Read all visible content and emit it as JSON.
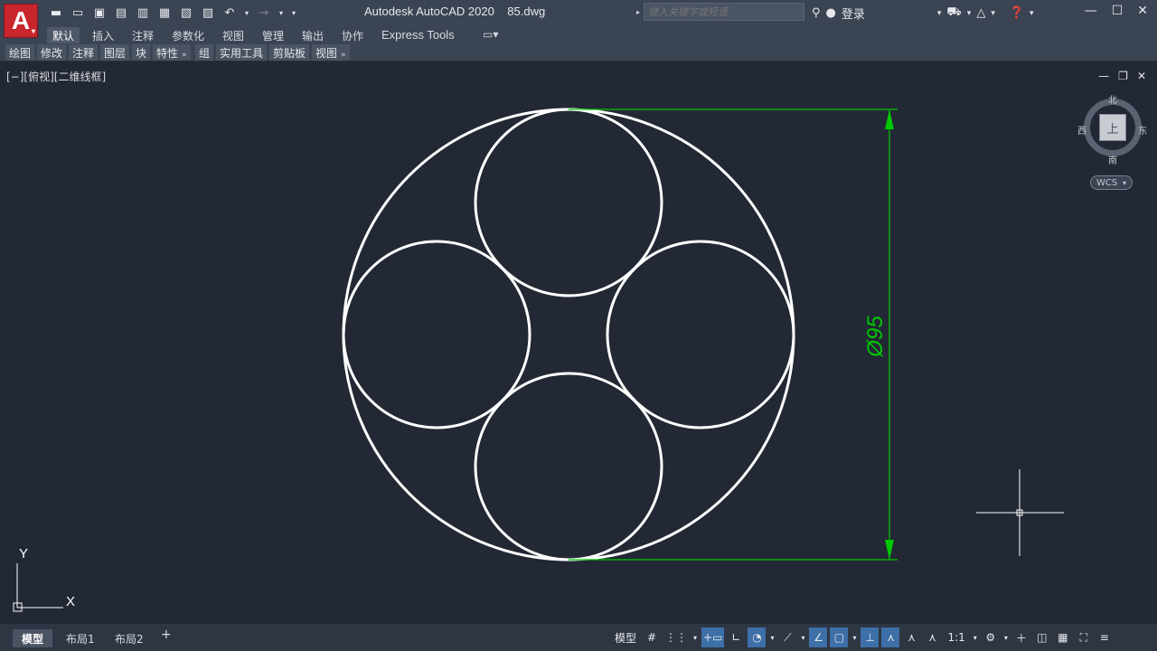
{
  "window": {
    "title": "Autodesk AutoCAD 2020    85.dwg",
    "app_letter": "A",
    "search_placeholder": "键入关键字或短语",
    "sign_in": "登录"
  },
  "ribbon": {
    "tabs": [
      {
        "label": "默认",
        "active": true
      },
      {
        "label": "插入"
      },
      {
        "label": "注释"
      },
      {
        "label": "参数化"
      },
      {
        "label": "视图"
      },
      {
        "label": "管理"
      },
      {
        "label": "输出"
      },
      {
        "label": "协作"
      },
      {
        "label": "Express Tools"
      }
    ],
    "panels": [
      "绘图",
      "修改",
      "注释",
      "图层",
      "块",
      "特性",
      "组",
      "实用工具",
      "剪贴板",
      "视图"
    ]
  },
  "viewport": {
    "label": "[−][俯视][二维线框]",
    "dimension_text": "Ø95",
    "ucs_x": "X",
    "ucs_y": "Y"
  },
  "viewcube": {
    "north": "北",
    "south": "南",
    "east": "东",
    "west": "西",
    "face": "上",
    "wcs": "WCS"
  },
  "layout_tabs": [
    {
      "label": "模型",
      "active": true
    },
    {
      "label": "布局1"
    },
    {
      "label": "布局2"
    }
  ],
  "status": {
    "model_label": "模型",
    "scale_label": "1:1"
  },
  "colors": {
    "background": "#222834",
    "geometry": "#ffffff",
    "dimension": "#00c800",
    "toggle_on": "#3d6fa8"
  }
}
